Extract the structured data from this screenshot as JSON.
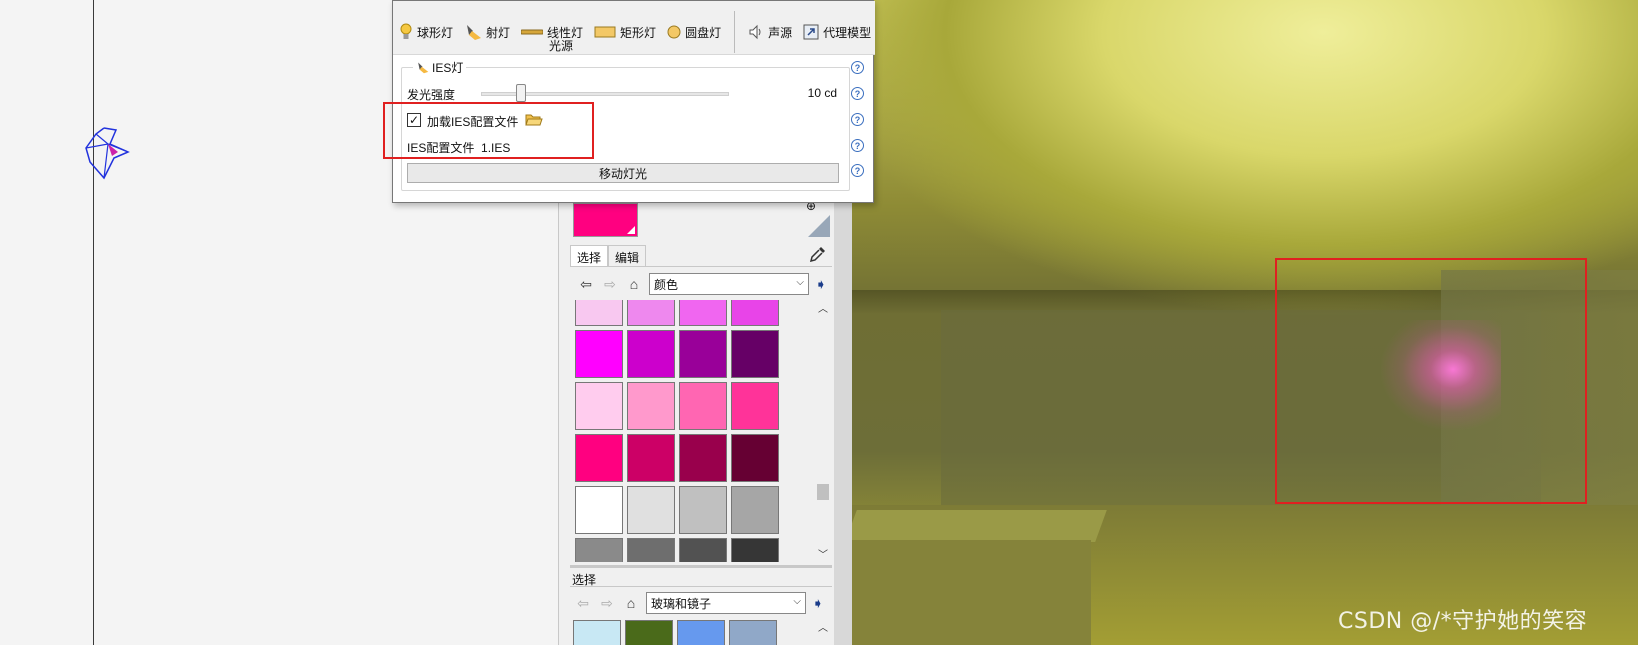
{
  "toolbar": {
    "items": [
      {
        "label": "球形灯",
        "icon": "bulb-icon"
      },
      {
        "label": "射灯",
        "icon": "spotlight-icon"
      },
      {
        "label": "线性灯",
        "icon": "linear-light-icon"
      },
      {
        "label": "矩形灯",
        "icon": "rect-light-icon"
      },
      {
        "label": "圆盘灯",
        "icon": "disk-light-icon"
      },
      {
        "label": "声源",
        "icon": "speaker-icon"
      },
      {
        "label": "代理模型",
        "icon": "proxy-model-icon"
      }
    ],
    "group_label": "光源"
  },
  "ies_group": {
    "title": "IES灯",
    "intensity_label": "发光强度",
    "intensity_value": "10 cd",
    "intensity_level": 0.16,
    "load_ies_label": "加载IES配置文件",
    "load_ies_checked": true,
    "ies_file_label": "IES配置文件",
    "ies_file_value": "1.IES",
    "move_light_label": "移动灯光",
    "help_symbol": "?"
  },
  "materials": {
    "current_color": "#ff0080",
    "tabs": [
      "选择",
      "编辑"
    ],
    "collection_dropdown": "颜色",
    "swatches": [
      "#f8c8f0",
      "#ee88ee",
      "#f066f0",
      "#e844e8",
      "#ff00ff",
      "#cc00cc",
      "#990099",
      "#660066",
      "#ffccee",
      "#ff99cc",
      "#ff66b2",
      "#ff3399",
      "#ff0080",
      "#cc0066",
      "#99004c",
      "#660033",
      "#ffffff",
      "#e0e0e0",
      "#c0c0c0",
      "#a6a6a6",
      "#8a8a8a",
      "#6e6e6e",
      "#525252",
      "#363636"
    ],
    "secondary_section_label": "选择",
    "secondary_dropdown": "玻璃和镜子",
    "thumbnails": [
      "#c8e8f4",
      "#4a6a1a",
      "#6699ee",
      "#90a8c8"
    ]
  },
  "watermark": "CSDN @/*守护她的笑容"
}
